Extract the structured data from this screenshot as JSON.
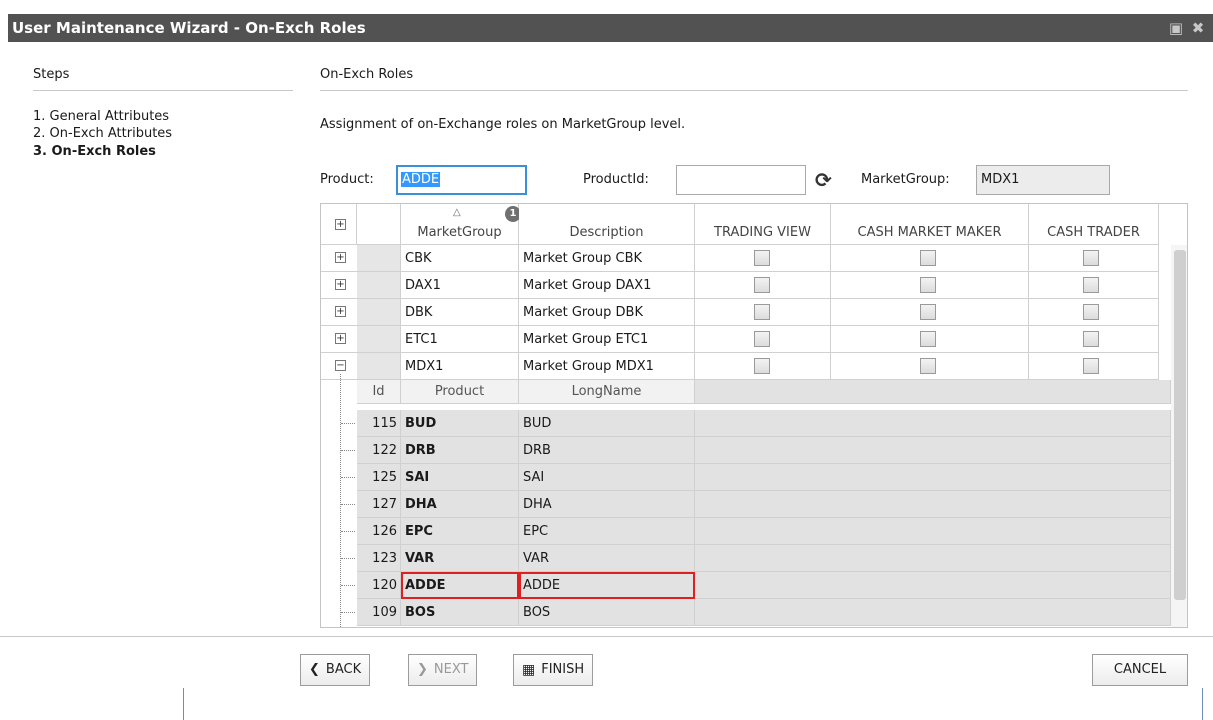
{
  "window": {
    "title": "User Maintenance Wizard  - On-Exch Roles",
    "icons": [
      "window-icon",
      "close-icon"
    ]
  },
  "steps": {
    "heading": "Steps",
    "items": [
      {
        "label": "1. General Attributes"
      },
      {
        "label": "2. On-Exch Attributes"
      },
      {
        "label": "3. On-Exch Roles"
      }
    ]
  },
  "pane": {
    "heading": "On-Exch Roles",
    "description": "Assignment of on-Exchange roles on MarketGroup level."
  },
  "filter": {
    "product_label": "Product:",
    "product_value": "ADDE",
    "productid_label": "ProductId:",
    "productid_value": "",
    "marketgroup_label": "MarketGroup:",
    "marketgroup_value": "MDX1"
  },
  "grid": {
    "columns": [
      "MarketGroup",
      "Description",
      "TRADING VIEW",
      "CASH MARKET MAKER",
      "CASH TRADER"
    ],
    "sort_badge": "1",
    "rows": [
      {
        "group": "CBK",
        "description": "Market Group CBK",
        "expander": "+"
      },
      {
        "group": "DAX1",
        "description": "Market Group DAX1",
        "expander": "+"
      },
      {
        "group": "DBK",
        "description": "Market Group DBK",
        "expander": "+"
      },
      {
        "group": "ETC1",
        "description": "Market Group ETC1",
        "expander": "+"
      },
      {
        "group": "MDX1",
        "description": "Market Group MDX1",
        "expander": "−"
      }
    ],
    "sub_columns": [
      "Id",
      "Product",
      "LongName"
    ],
    "sub_rows": [
      {
        "id": "115",
        "product": "BUD",
        "longname": "BUD"
      },
      {
        "id": "122",
        "product": "DRB",
        "longname": "DRB"
      },
      {
        "id": "125",
        "product": "SAI",
        "longname": "SAI"
      },
      {
        "id": "127",
        "product": "DHA",
        "longname": "DHA"
      },
      {
        "id": "126",
        "product": "EPC",
        "longname": "EPC"
      },
      {
        "id": "123",
        "product": "VAR",
        "longname": "VAR"
      },
      {
        "id": "120",
        "product": "ADDE",
        "longname": "ADDE"
      },
      {
        "id": "109",
        "product": "BOS",
        "longname": "BOS"
      }
    ]
  },
  "buttons": {
    "back": "BACK",
    "next": "NEXT",
    "finish": "FINISH",
    "cancel": "CANCEL"
  },
  "colors": {
    "titlebar": "#525252",
    "highlight": "#e02020",
    "focus": "#3a8fd9"
  }
}
